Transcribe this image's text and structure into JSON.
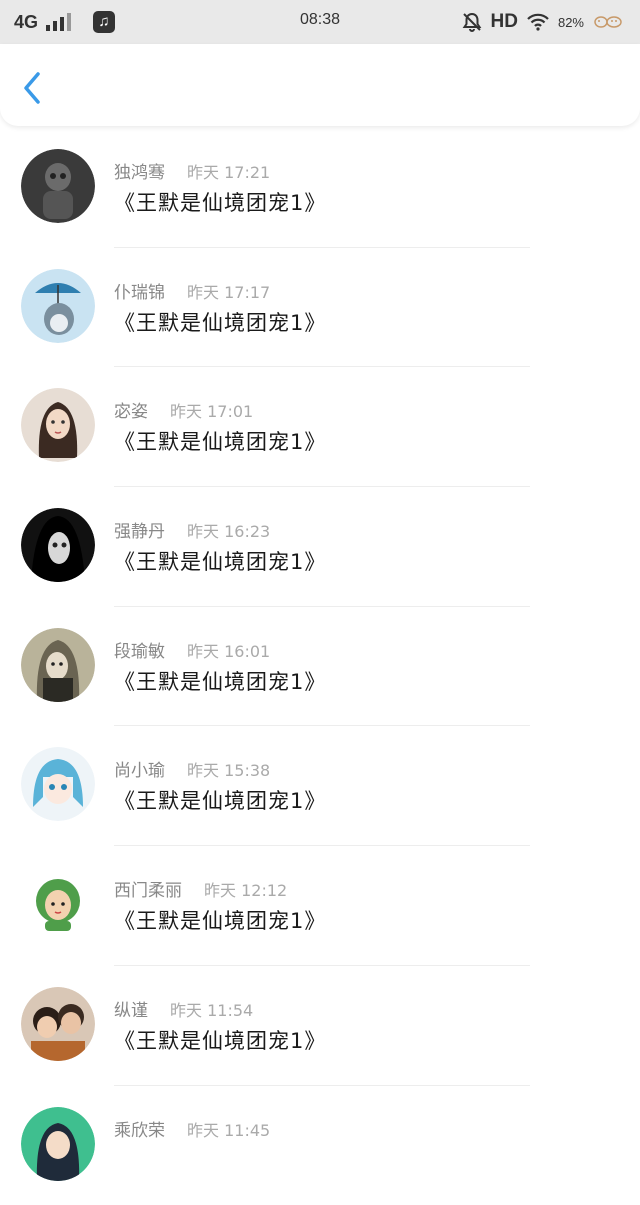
{
  "status_bar": {
    "network": "4G",
    "time": "08:38",
    "hd": "HD",
    "battery": "82%"
  },
  "header": {
    "back_icon": "chevron-left-icon"
  },
  "colors": {
    "accent": "#3a9ae8",
    "name_text": "#888888",
    "message_text": "#1a1a1a"
  },
  "messages": [
    {
      "name": "独鸿骞",
      "time": "昨天 17:21",
      "text": "《王默是仙境团宠1》",
      "avatar_color": "#4a4a4a"
    },
    {
      "name": "仆瑞锦",
      "time": "昨天 17:17",
      "text": "《王默是仙境团宠1》",
      "avatar_color": "#9fc6e3"
    },
    {
      "name": "宓姿",
      "time": "昨天 17:01",
      "text": "《王默是仙境团宠1》",
      "avatar_color": "#c7b6a8"
    },
    {
      "name": "强静丹",
      "time": "昨天 16:23",
      "text": "《王默是仙境团宠1》",
      "avatar_color": "#222222"
    },
    {
      "name": "段瑜敏",
      "time": "昨天 16:01",
      "text": "《王默是仙境团宠1》",
      "avatar_color": "#5a5a4a"
    },
    {
      "name": "尚小瑜",
      "time": "昨天 15:38",
      "text": "《王默是仙境团宠1》",
      "avatar_color": "#bfe0ef"
    },
    {
      "name": "西门柔丽",
      "time": "昨天 12:12",
      "text": "《王默是仙境团宠1》",
      "avatar_color": "#6fb96a"
    },
    {
      "name": "纵谨",
      "time": "昨天 11:54",
      "text": "《王默是仙境团宠1》",
      "avatar_color": "#d9a982"
    },
    {
      "name": "乘欣荣",
      "time": "昨天 11:45",
      "text": "",
      "avatar_color": "#3fbf8f"
    }
  ]
}
